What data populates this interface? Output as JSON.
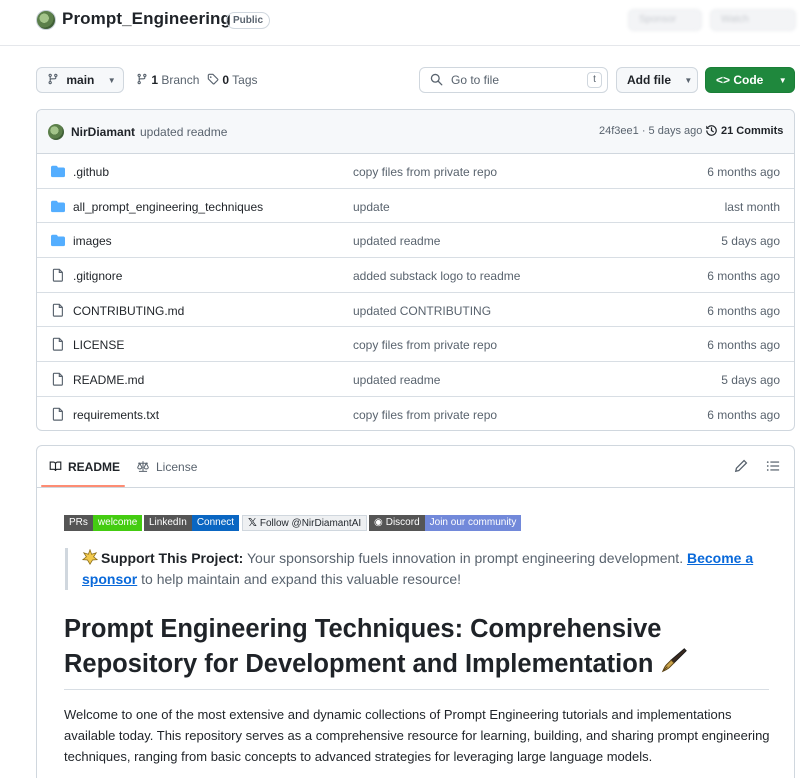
{
  "repo": {
    "name": "Prompt_Engineering",
    "visibility": "Public",
    "blurred_actions": [
      "Sponsor",
      "Watch"
    ]
  },
  "toolbar": {
    "branch": "main",
    "branches_count": "1",
    "branches_label": "Branch",
    "tags_count": "0",
    "tags_label": "Tags",
    "search_placeholder": "Go to file",
    "search_shortcut": "t",
    "add_file_label": "Add file",
    "code_label": "Code",
    "code_color": "#1f883d"
  },
  "latest_commit": {
    "author": "NirDiamant",
    "message": "updated readme",
    "meta": "24f3ee1 · 5 days ago",
    "commits_label": "21 Commits"
  },
  "files": [
    {
      "type": "folder",
      "name": ".github",
      "message": "copy files from private repo",
      "date": "6 months ago"
    },
    {
      "type": "folder",
      "name": "all_prompt_engineering_techniques",
      "message": "update",
      "date": "last month"
    },
    {
      "type": "folder",
      "name": "images",
      "message": "updated readme",
      "date": "5 days ago"
    },
    {
      "type": "file",
      "name": ".gitignore",
      "message": "added substack logo to readme",
      "date": "6 months ago"
    },
    {
      "type": "file",
      "name": "CONTRIBUTING.md",
      "message": "updated CONTRIBUTING",
      "date": "6 months ago"
    },
    {
      "type": "file",
      "name": "LICENSE",
      "message": "copy files from private repo",
      "date": "6 months ago"
    },
    {
      "type": "file",
      "name": "README.md",
      "message": "updated readme",
      "date": "5 days ago"
    },
    {
      "type": "file",
      "name": "requirements.txt",
      "message": "copy files from private repo",
      "date": "6 months ago"
    }
  ],
  "readme": {
    "tabs": {
      "readme": "README",
      "license": "License"
    },
    "badges": [
      {
        "left": "PRs",
        "right": "welcome"
      },
      {
        "left": "LinkedIn",
        "right": "Connect"
      },
      {
        "left": "Follow @NirDiamantAI",
        "right": ""
      },
      {
        "left": "Discord",
        "right": "Join our community"
      }
    ],
    "callout": {
      "strong": "Support This Project:",
      "text": " Your sponsorship fuels innovation in prompt engineering development. ",
      "link": "Become a sponsor",
      "tail": " to help maintain and expand this valuable resource!"
    },
    "heading": "Prompt Engineering Techniques: Comprehensive Repository for Development and Implementation",
    "paragraph": "Welcome to one of the most extensive and dynamic collections of Prompt Engineering tutorials and implementations available today. This repository serves as a comprehensive resource for learning, building, and sharing prompt engineering techniques, ranging from basic concepts to advanced strategies for leveraging large language models."
  },
  "colors": {
    "link": "#0969da",
    "folder": "#54aeff",
    "tab_underline": "#fd8c73"
  },
  "icons": {
    "branch": "git-branch-icon",
    "tag": "tag-icon",
    "search": "search-icon",
    "history": "history-icon",
    "folder": "folder-icon",
    "file": "file-icon",
    "book": "book-icon",
    "law": "law-icon",
    "pencil": "pencil-icon",
    "list": "list-icon"
  }
}
